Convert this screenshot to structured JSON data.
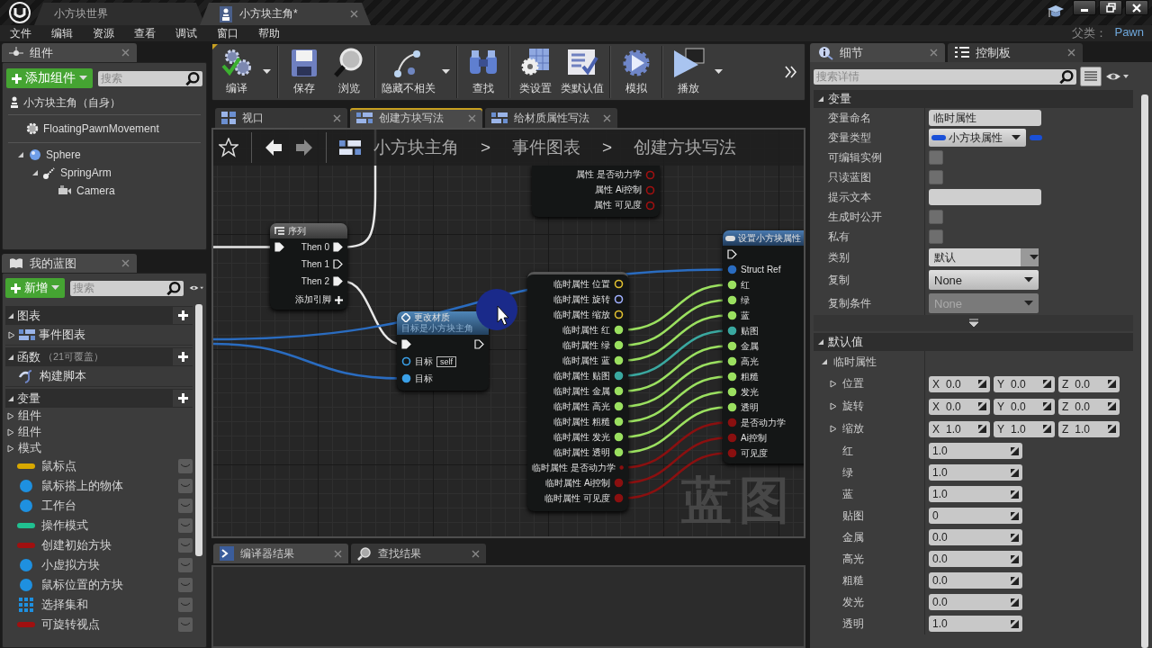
{
  "title_bar": {
    "tabs": [
      {
        "label": "小方块世界",
        "selected": false
      },
      {
        "label": "小方块主角*",
        "selected": true
      }
    ]
  },
  "menu": [
    "文件",
    "编辑",
    "资源",
    "查看",
    "调试",
    "窗口",
    "帮助"
  ],
  "parent_class": {
    "label": "父类：",
    "value": "Pawn"
  },
  "components": {
    "tab": "组件",
    "add_button": "添加组件",
    "search": {
      "placeholder": "搜索"
    },
    "root": "小方块主角（自身）",
    "movement": "FloatingPawnMovement",
    "tree": [
      {
        "label": "Sphere",
        "kind": "sphere",
        "expanded": true,
        "children": [
          {
            "label": "SpringArm",
            "kind": "arm",
            "expanded": true,
            "children": [
              {
                "label": "Camera",
                "kind": "camera"
              }
            ]
          }
        ]
      }
    ]
  },
  "my_blueprint": {
    "tab": "我的蓝图",
    "new_button": "新增",
    "search": {
      "placeholder": "搜索"
    },
    "sections": [
      {
        "title": "图表",
        "items": [
          {
            "label": "事件图表",
            "kind": "graph"
          }
        ]
      },
      {
        "title": "函数",
        "note": "（21可覆盖）",
        "items": [
          {
            "label": "构建脚本",
            "kind": "function"
          }
        ]
      },
      {
        "title": "变量",
        "items": [
          {
            "label": "组件",
            "kind": "category"
          },
          {
            "label": "组件",
            "kind": "category"
          },
          {
            "label": "模式",
            "kind": "category"
          },
          {
            "label": "鼠标点",
            "kind": "pill",
            "color": "#d8a800"
          },
          {
            "label": "鼠标搭上的物体",
            "kind": "ball",
            "color": "#1e90e0"
          },
          {
            "label": "工作台",
            "kind": "ball",
            "color": "#1e90e0"
          },
          {
            "label": "操作模式",
            "kind": "pill",
            "color": "#20c090"
          },
          {
            "label": "创建初始方块",
            "kind": "pill",
            "color": "#a01010"
          },
          {
            "label": "小虚拟方块",
            "kind": "ball",
            "color": "#1e90e0"
          },
          {
            "label": "鼠标位置的方块",
            "kind": "ball",
            "color": "#1e90e0"
          },
          {
            "label": "选择集和",
            "kind": "grid",
            "color": "#1e90e0"
          },
          {
            "label": "可旋转视点",
            "kind": "pill",
            "color": "#a01010"
          }
        ]
      }
    ]
  },
  "toolbar": [
    {
      "label": "编译",
      "kind": "compile",
      "dropdown": true
    },
    {
      "label": "保存",
      "kind": "save",
      "dropdown": false
    },
    {
      "label": "浏览",
      "kind": "browse",
      "dropdown": false
    },
    {
      "label": "隐藏不相关",
      "kind": "hide",
      "dropdown": true
    },
    {
      "label": "查找",
      "kind": "find",
      "dropdown": false
    },
    {
      "label": "类设置",
      "kind": "settings",
      "dropdown": false
    },
    {
      "label": "类默认值",
      "kind": "defaults",
      "dropdown": false
    },
    {
      "label": "模拟",
      "kind": "simulate",
      "dropdown": false
    },
    {
      "label": "播放",
      "kind": "play",
      "dropdown": true
    }
  ],
  "doc_tabs": [
    {
      "label": "视口",
      "kind": "viewport",
      "selected": false
    },
    {
      "label": "创建方块写法",
      "kind": "graph",
      "selected": true
    },
    {
      "label": "给材质属性写法",
      "kind": "graph",
      "selected": false
    }
  ],
  "graph": {
    "breadcrumb": [
      {
        "label": "小方块主角",
        "kind": "crumb"
      },
      {
        "label": ">",
        "kind": "separator"
      },
      {
        "label": "事件图表",
        "kind": "crumb"
      },
      {
        "label": ">",
        "kind": "separator"
      },
      {
        "label": "创建方块写法",
        "kind": "crumb"
      }
    ],
    "nodes": [
      {
        "kind": "partial",
        "pins": [
          {
            "label": "属性 是否动力学",
            "color": "#a01010",
            "linked": false
          },
          {
            "label": "属性 Ai控制",
            "color": "#a01010",
            "linked": false
          },
          {
            "label": "属性 可见度",
            "color": "#a01010",
            "linked": false
          }
        ]
      },
      {
        "kind": "sequence",
        "title": "序列",
        "exec_in_linked": true,
        "pins": [
          {
            "label": "Then 0",
            "linked": true
          },
          {
            "label": "Then 1",
            "linked": false
          },
          {
            "label": "Then 2",
            "linked": true
          }
        ],
        "add_pin": "添加引脚"
      },
      {
        "kind": "function",
        "title": "更改材质",
        "subtitle": "目标是小方块主角",
        "exec_in_linked": true,
        "exec_out_linked": false,
        "pins": [
          {
            "label": "目标",
            "value": "self",
            "color": "#3aa0e8",
            "linked": false
          },
          {
            "label": "目标",
            "color": "#3aa0e8",
            "linked": true
          }
        ]
      },
      {
        "kind": "break",
        "pins": [
          {
            "label": "临时属性 位置",
            "color": "#e0c030",
            "linked": false
          },
          {
            "label": "临时属性 旋转",
            "color": "#a0b0ff",
            "linked": false
          },
          {
            "label": "临时属性 缩放",
            "color": "#e0c030",
            "linked": false
          },
          {
            "label": "临时属性 红",
            "color": "#9be060",
            "linked": true
          },
          {
            "label": "临时属性 绿",
            "color": "#9be060",
            "linked": true
          },
          {
            "label": "临时属性 蓝",
            "color": "#9be060",
            "linked": true
          },
          {
            "label": "临时属性 贴图",
            "color": "#3aa8a0",
            "linked": true
          },
          {
            "label": "临时属性 金属",
            "color": "#9be060",
            "linked": true
          },
          {
            "label": "临时属性 高光",
            "color": "#9be060",
            "linked": true
          },
          {
            "label": "临时属性 粗糙",
            "color": "#9be060",
            "linked": true
          },
          {
            "label": "临时属性 发光",
            "color": "#9be060",
            "linked": true
          },
          {
            "label": "临时属性 透明",
            "color": "#9be060",
            "linked": true
          },
          {
            "label": "临时属性 是否动力学",
            "color": "#8a1010",
            "linked": true
          },
          {
            "label": "临时属性 Ai控制",
            "color": "#8a1010",
            "linked": true
          },
          {
            "label": "临时属性 可见度",
            "color": "#8a1010",
            "linked": true
          }
        ]
      },
      {
        "kind": "set",
        "title": "设置小方块属性",
        "exec_in_linked": false,
        "pins": [
          {
            "label": "Struct Ref",
            "color": "#2a6cc0",
            "linked": true
          },
          {
            "label": "红",
            "color": "#9be060",
            "linked": true
          },
          {
            "label": "绿",
            "color": "#9be060",
            "linked": true
          },
          {
            "label": "蓝",
            "color": "#9be060",
            "linked": true
          },
          {
            "label": "贴图",
            "color": "#3aa8a0",
            "linked": true
          },
          {
            "label": "金属",
            "color": "#9be060",
            "linked": true
          },
          {
            "label": "高光",
            "color": "#9be060",
            "linked": true
          },
          {
            "label": "粗糙",
            "color": "#9be060",
            "linked": true
          },
          {
            "label": "发光",
            "color": "#9be060",
            "linked": true
          },
          {
            "label": "透明",
            "color": "#9be060",
            "linked": true
          },
          {
            "label": "是否动力学",
            "color": "#8a1010",
            "linked": true
          },
          {
            "label": "Ai控制",
            "color": "#8a1010",
            "linked": true
          },
          {
            "label": "可见度",
            "color": "#8a1010",
            "linked": true
          }
        ]
      }
    ],
    "corner_label": "蓝图"
  },
  "results": {
    "tabs": [
      {
        "label": "编译器结果",
        "kind": "compiler",
        "selected": true
      },
      {
        "label": "查找结果",
        "kind": "find",
        "selected": false
      }
    ]
  },
  "details": {
    "tabs": [
      {
        "label": "细节",
        "kind": "details",
        "selected": true
      },
      {
        "label": "控制板",
        "kind": "palette",
        "selected": false
      }
    ],
    "search": {
      "placeholder": "搜索详情"
    },
    "sections": [
      {
        "title": "变量",
        "rows": [
          {
            "label": "变量命名",
            "kind": "text",
            "value": "临时属性"
          },
          {
            "label": "变量类型",
            "kind": "type",
            "value": "小方块属性"
          },
          {
            "label": "可编辑实例",
            "kind": "checkbox",
            "checked": false
          },
          {
            "label": "只读蓝图",
            "kind": "checkbox",
            "checked": false
          },
          {
            "label": "提示文本",
            "kind": "text"
          },
          {
            "label": "生成时公开",
            "kind": "checkbox",
            "checked": false
          },
          {
            "label": "私有",
            "kind": "checkbox",
            "checked": false
          },
          {
            "label": "类别",
            "kind": "combo",
            "value": "默认"
          },
          {
            "label": "复制",
            "kind": "dropdown",
            "value": "None",
            "disabled": false
          },
          {
            "label": "复制条件",
            "kind": "dropdown",
            "value": "None",
            "disabled": true
          }
        ]
      },
      {
        "title": "默认值",
        "group": "临时属性",
        "rows": [
          {
            "label": "位置",
            "kind": "vector",
            "expanded": false,
            "fields": [
              {
                "axis": "X",
                "value": "0.0"
              },
              {
                "axis": "Y",
                "value": "0.0"
              },
              {
                "axis": "Z",
                "value": "0.0"
              }
            ]
          },
          {
            "label": "旋转",
            "kind": "vector",
            "expanded": false,
            "fields": [
              {
                "axis": "X",
                "value": "0.0"
              },
              {
                "axis": "Y",
                "value": "0.0"
              },
              {
                "axis": "Z",
                "value": "0.0"
              }
            ]
          },
          {
            "label": "缩放",
            "kind": "vector",
            "expanded": false,
            "fields": [
              {
                "axis": "X",
                "value": "1.0"
              },
              {
                "axis": "Y",
                "value": "1.0"
              },
              {
                "axis": "Z",
                "value": "1.0"
              }
            ]
          },
          {
            "label": "红",
            "kind": "number",
            "value": "1.0"
          },
          {
            "label": "绿",
            "kind": "number",
            "value": "1.0"
          },
          {
            "label": "蓝",
            "kind": "number",
            "value": "1.0"
          },
          {
            "label": "贴图",
            "kind": "number",
            "value": "0"
          },
          {
            "label": "金属",
            "kind": "number",
            "value": "0.0"
          },
          {
            "label": "高光",
            "kind": "number",
            "value": "0.0"
          },
          {
            "label": "粗糙",
            "kind": "number",
            "value": "0.0"
          },
          {
            "label": "发光",
            "kind": "number",
            "value": "0.0"
          },
          {
            "label": "透明",
            "kind": "number",
            "value": "1.0"
          }
        ]
      }
    ]
  }
}
